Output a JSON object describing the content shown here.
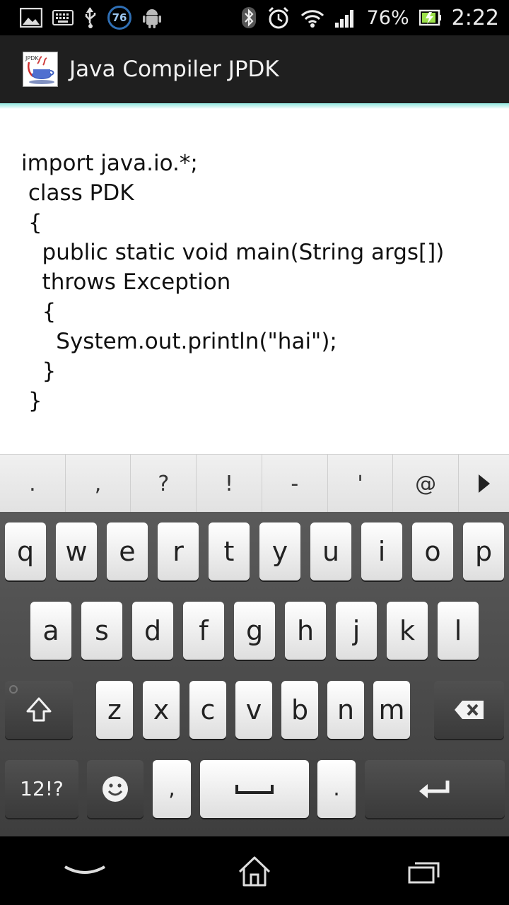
{
  "status_bar": {
    "notification_badge": "76",
    "battery_percent": "76%",
    "clock": "2:22",
    "icons": [
      "image-icon",
      "keyboard-icon",
      "usb-icon",
      "badge-76-icon",
      "android-icon",
      "bluetooth-icon",
      "alarm-icon",
      "wifi-icon",
      "signal-icon",
      "battery-icon"
    ]
  },
  "action_bar": {
    "app_icon_text": "JPDK",
    "title": "Java Compiler JPDK"
  },
  "editor": {
    "lines": [
      "import java.io.*;",
      " class PDK",
      " {",
      "   public static void main(String args[])",
      "   throws Exception",
      "   {",
      "     System.out.println(\"hai\");",
      "   }",
      " }"
    ]
  },
  "suggestions": {
    "items": [
      ".",
      ",",
      "?",
      "!",
      "-",
      "'",
      "@"
    ],
    "more_icon": "play-arrow-icon"
  },
  "keyboard": {
    "row1": [
      "q",
      "w",
      "e",
      "r",
      "t",
      "y",
      "u",
      "i",
      "o",
      "p"
    ],
    "row2": [
      "a",
      "s",
      "d",
      "f",
      "g",
      "h",
      "j",
      "k",
      "l"
    ],
    "row3": [
      "z",
      "x",
      "c",
      "v",
      "b",
      "n",
      "m"
    ],
    "symbols_label": "12!?",
    "comma_label": ",",
    "period_label": ".",
    "icons": [
      "shift-icon",
      "backspace-icon",
      "emoji-icon",
      "space-icon",
      "enter-icon"
    ]
  },
  "navbar": {
    "icons": [
      "back-icon",
      "home-icon",
      "recent-apps-icon"
    ]
  },
  "colors": {
    "accent": "#8fe6df",
    "action_bar": "#1f1f1f",
    "keyboard_bg": "#4a4a4a"
  }
}
